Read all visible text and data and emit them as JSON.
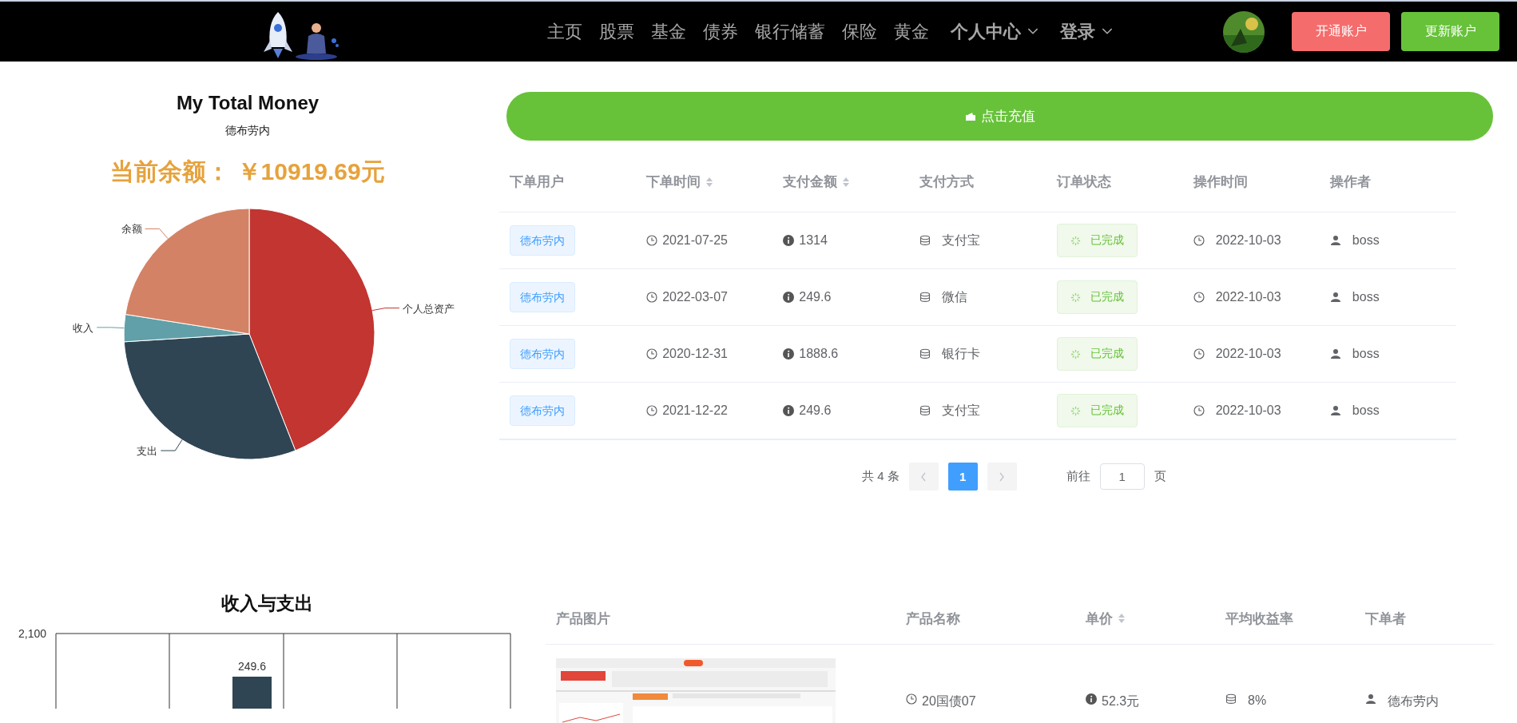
{
  "nav": {
    "menu": [
      {
        "label": "主页",
        "bold": false,
        "dropdown": false
      },
      {
        "label": "股票",
        "bold": false,
        "dropdown": false
      },
      {
        "label": "基金",
        "bold": false,
        "dropdown": false
      },
      {
        "label": "债券",
        "bold": false,
        "dropdown": false
      },
      {
        "label": "银行储蓄",
        "bold": false,
        "dropdown": false
      },
      {
        "label": "保险",
        "bold": false,
        "dropdown": false
      },
      {
        "label": "黄金",
        "bold": false,
        "dropdown": false
      },
      {
        "label": "个人中心",
        "bold": true,
        "dropdown": true
      },
      {
        "label": "登录",
        "bold": true,
        "dropdown": true
      }
    ],
    "buttons": [
      {
        "label": "开通账户",
        "kind": "danger"
      },
      {
        "label": "更新账户",
        "kind": "success"
      }
    ]
  },
  "summary": {
    "title": "My Total Money",
    "subtitle": "德布劳内",
    "balance": "当前余额： ￥10919.69元"
  },
  "pie": {
    "chart_data": {
      "type": "pie",
      "categories": [
        "个人总资产",
        "支出",
        "收入",
        "余额"
      ],
      "values": [
        44,
        30,
        3.5,
        22.5
      ]
    }
  },
  "recharge": {
    "label": "点击充值"
  },
  "orders": {
    "columns": [
      {
        "label": "下单用户",
        "sortable": false
      },
      {
        "label": "下单时间",
        "sortable": true
      },
      {
        "label": "支付金额",
        "sortable": true
      },
      {
        "label": "支付方式",
        "sortable": false
      },
      {
        "label": "订单状态",
        "sortable": false
      },
      {
        "label": "操作时间",
        "sortable": false
      },
      {
        "label": "操作者",
        "sortable": false
      }
    ],
    "rows": [
      {
        "user": "德布劳内",
        "order_time": "2021-07-25",
        "amount": "1314",
        "payment": "支付宝",
        "status": "已完成",
        "op_time": "2022-10-03",
        "operator": "boss"
      },
      {
        "user": "德布劳内",
        "order_time": "2022-03-07",
        "amount": "249.6",
        "payment": "微信",
        "status": "已完成",
        "op_time": "2022-10-03",
        "operator": "boss"
      },
      {
        "user": "德布劳内",
        "order_time": "2020-12-31",
        "amount": "1888.6",
        "payment": "银行卡",
        "status": "已完成",
        "op_time": "2022-10-03",
        "operator": "boss"
      },
      {
        "user": "德布劳内",
        "order_time": "2021-12-22",
        "amount": "249.6",
        "payment": "支付宝",
        "status": "已完成",
        "op_time": "2022-10-03",
        "operator": "boss"
      }
    ]
  },
  "pagination": {
    "total": "共 4 条",
    "pages": [
      {
        "label": "1",
        "selected": true
      }
    ],
    "goto_prefix": "前往",
    "goto_value": "1",
    "goto_suffix": "页"
  },
  "bar_chart": {
    "title": "收入与支出",
    "y_tick": "2,100",
    "bar_label": "249.6"
  },
  "products": {
    "columns": [
      {
        "label": "产品图片",
        "sortable": false
      },
      {
        "label": "产品名称",
        "sortable": false
      },
      {
        "label": "单价",
        "sortable": true
      },
      {
        "label": "平均收益率",
        "sortable": false
      },
      {
        "label": "下单者",
        "sortable": false
      }
    ],
    "rows": [
      {
        "name": "20国债07",
        "price": "52.3元",
        "yield": "8%",
        "buyer": "德布劳内"
      }
    ]
  }
}
